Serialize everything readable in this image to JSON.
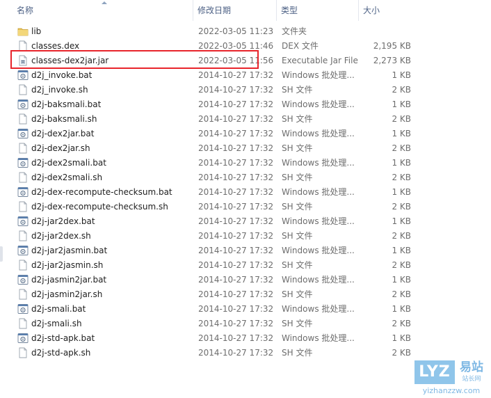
{
  "columns": {
    "name": "名称",
    "date": "修改日期",
    "type": "类型",
    "size": "大小"
  },
  "files": [
    {
      "name": "lib",
      "date": "2022-03-05 11:23",
      "type": "文件夹",
      "size": "",
      "icon": "folder-icon"
    },
    {
      "name": "classes.dex",
      "date": "2022-03-05 11:46",
      "type": "DEX 文件",
      "size": "2,195 KB",
      "icon": "file-icon"
    },
    {
      "name": "classes-dex2jar.jar",
      "date": "2022-03-05 11:56",
      "type": "Executable Jar File",
      "size": "2,273 KB",
      "icon": "jar-file-icon"
    },
    {
      "name": "d2j_invoke.bat",
      "date": "2014-10-27 17:32",
      "type": "Windows 批处理...",
      "size": "1 KB",
      "icon": "batch-file-icon"
    },
    {
      "name": "d2j_invoke.sh",
      "date": "2014-10-27 17:32",
      "type": "SH 文件",
      "size": "2 KB",
      "icon": "file-icon"
    },
    {
      "name": "d2j-baksmali.bat",
      "date": "2014-10-27 17:32",
      "type": "Windows 批处理...",
      "size": "1 KB",
      "icon": "batch-file-icon"
    },
    {
      "name": "d2j-baksmali.sh",
      "date": "2014-10-27 17:32",
      "type": "SH 文件",
      "size": "2 KB",
      "icon": "file-icon"
    },
    {
      "name": "d2j-dex2jar.bat",
      "date": "2014-10-27 17:32",
      "type": "Windows 批处理...",
      "size": "1 KB",
      "icon": "batch-file-icon"
    },
    {
      "name": "d2j-dex2jar.sh",
      "date": "2014-10-27 17:32",
      "type": "SH 文件",
      "size": "2 KB",
      "icon": "file-icon"
    },
    {
      "name": "d2j-dex2smali.bat",
      "date": "2014-10-27 17:32",
      "type": "Windows 批处理...",
      "size": "1 KB",
      "icon": "batch-file-icon"
    },
    {
      "name": "d2j-dex2smali.sh",
      "date": "2014-10-27 17:32",
      "type": "SH 文件",
      "size": "2 KB",
      "icon": "file-icon"
    },
    {
      "name": "d2j-dex-recompute-checksum.bat",
      "date": "2014-10-27 17:32",
      "type": "Windows 批处理...",
      "size": "1 KB",
      "icon": "batch-file-icon"
    },
    {
      "name": "d2j-dex-recompute-checksum.sh",
      "date": "2014-10-27 17:32",
      "type": "SH 文件",
      "size": "2 KB",
      "icon": "file-icon"
    },
    {
      "name": "d2j-jar2dex.bat",
      "date": "2014-10-27 17:32",
      "type": "Windows 批处理...",
      "size": "1 KB",
      "icon": "batch-file-icon"
    },
    {
      "name": "d2j-jar2dex.sh",
      "date": "2014-10-27 17:32",
      "type": "SH 文件",
      "size": "2 KB",
      "icon": "file-icon"
    },
    {
      "name": "d2j-jar2jasmin.bat",
      "date": "2014-10-27 17:32",
      "type": "Windows 批处理...",
      "size": "1 KB",
      "icon": "batch-file-icon"
    },
    {
      "name": "d2j-jar2jasmin.sh",
      "date": "2014-10-27 17:32",
      "type": "SH 文件",
      "size": "2 KB",
      "icon": "file-icon"
    },
    {
      "name": "d2j-jasmin2jar.bat",
      "date": "2014-10-27 17:32",
      "type": "Windows 批处理...",
      "size": "1 KB",
      "icon": "batch-file-icon"
    },
    {
      "name": "d2j-jasmin2jar.sh",
      "date": "2014-10-27 17:32",
      "type": "SH 文件",
      "size": "2 KB",
      "icon": "file-icon"
    },
    {
      "name": "d2j-smali.bat",
      "date": "2014-10-27 17:32",
      "type": "Windows 批处理...",
      "size": "1 KB",
      "icon": "batch-file-icon"
    },
    {
      "name": "d2j-smali.sh",
      "date": "2014-10-27 17:32",
      "type": "SH 文件",
      "size": "2 KB",
      "icon": "file-icon"
    },
    {
      "name": "d2j-std-apk.bat",
      "date": "2014-10-27 17:32",
      "type": "Windows 批处理...",
      "size": "1 KB",
      "icon": "batch-file-icon"
    },
    {
      "name": "d2j-std-apk.sh",
      "date": "2014-10-27 17:32",
      "type": "SH 文件",
      "size": "2 KB",
      "icon": "file-icon"
    }
  ],
  "watermark": {
    "logo": "LYZ",
    "brand": "易站",
    "tagline": "站长网",
    "url": "yizhanzzw.com"
  },
  "colors": {
    "highlight": "#e8242b",
    "header_text": "#4d6185",
    "folder": "#e8c25a",
    "watermark": "#7fb8e4"
  }
}
